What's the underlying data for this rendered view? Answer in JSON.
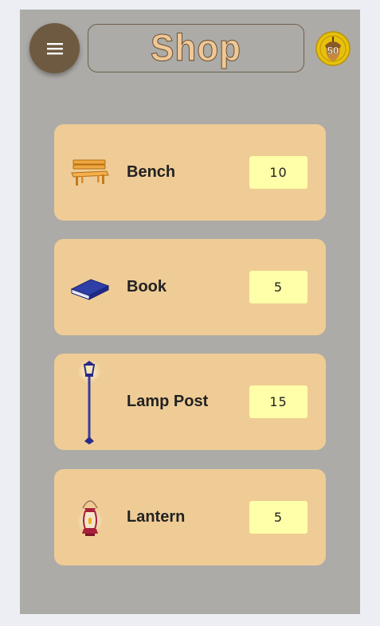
{
  "header": {
    "title": "Shop",
    "coin_count": "50",
    "menu_icon": "hamburger-menu-icon",
    "coin_icon": "acorn-coin-icon"
  },
  "items": [
    {
      "name": "Bench",
      "price": "10",
      "icon": "bench-icon"
    },
    {
      "name": "Book",
      "price": "5",
      "icon": "book-icon"
    },
    {
      "name": "Lamp Post",
      "price": "15",
      "icon": "lamp-post-icon"
    },
    {
      "name": "Lantern",
      "price": "5",
      "icon": "lantern-icon"
    }
  ],
  "colors": {
    "background": "#acaba7",
    "card": "#efcc96",
    "price": "#feffa8",
    "menu_button": "#6e5a40",
    "title": "#f0c896"
  }
}
